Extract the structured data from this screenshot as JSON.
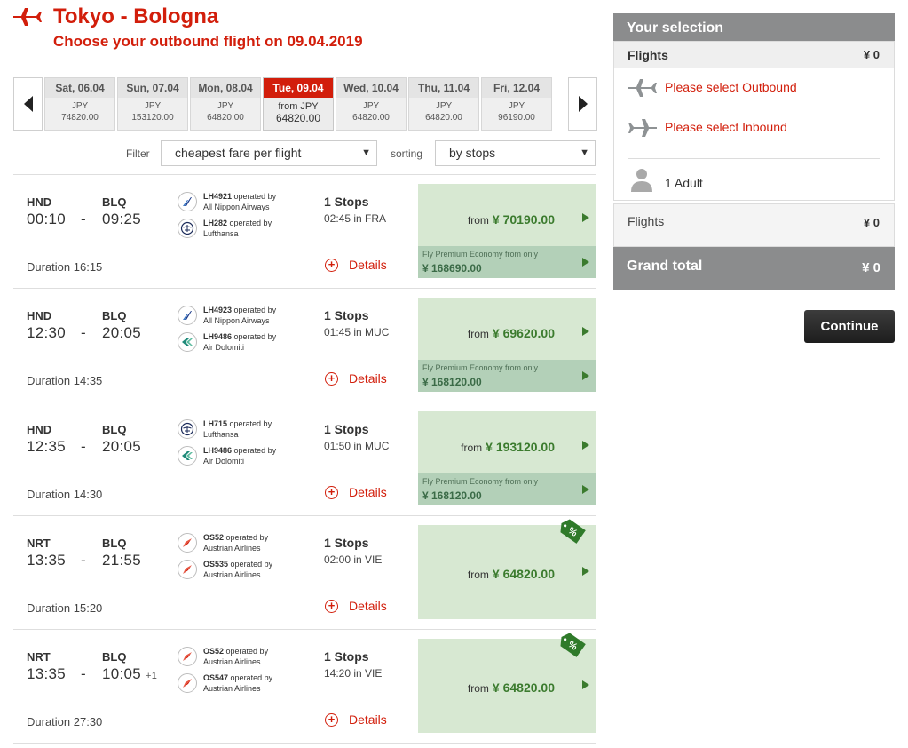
{
  "header": {
    "title": "Tokyo - Bologna",
    "subtitle": "Choose your outbound flight on 09.04.2019"
  },
  "date_carousel": {
    "prev_icon": "chevron-left-icon",
    "next_icon": "chevron-right-icon",
    "dates": [
      {
        "day": "Sat, 06.04",
        "currency": "JPY",
        "price": "74820.00",
        "active": false
      },
      {
        "day": "Sun, 07.04",
        "currency": "JPY",
        "price": "153120.00",
        "active": false
      },
      {
        "day": "Mon, 08.04",
        "currency": "JPY",
        "price": "64820.00",
        "active": false
      },
      {
        "day": "Tue, 09.04",
        "currency": "from JPY",
        "price": "64820.00",
        "active": true
      },
      {
        "day": "Wed, 10.04",
        "currency": "JPY",
        "price": "64820.00",
        "active": false
      },
      {
        "day": "Thu, 11.04",
        "currency": "JPY",
        "price": "64820.00",
        "active": false
      },
      {
        "day": "Fri, 12.04",
        "currency": "JPY",
        "price": "96190.00",
        "active": false
      }
    ]
  },
  "filters": {
    "filter_label": "Filter",
    "filter_value": "cheapest fare per flight",
    "sort_label": "sorting",
    "sort_value": "by stops"
  },
  "flights": [
    {
      "from": "HND",
      "to": "BLQ",
      "dep": "00:10",
      "dash": "-",
      "arr": "09:25",
      "plus_day": "",
      "duration": "Duration 16:15",
      "segments": [
        {
          "flight": "LH4921",
          "op": "operated by",
          "carrier": "All Nippon Airways",
          "logo": "ana"
        },
        {
          "flight": "LH282",
          "op": "operated by",
          "carrier": "Lufthansa",
          "logo": "lufthansa"
        }
      ],
      "stops": "1 Stops",
      "stop_info": "02:45 in FRA",
      "details": "Details",
      "fare_from": "from",
      "fare": "¥ 70190.00",
      "premium_label": "Fly Premium Economy from only",
      "premium_fare": "¥ 168690.00",
      "deal": false
    },
    {
      "from": "HND",
      "to": "BLQ",
      "dep": "12:30",
      "dash": "-",
      "arr": "20:05",
      "plus_day": "",
      "duration": "Duration 14:35",
      "segments": [
        {
          "flight": "LH4923",
          "op": "operated by",
          "carrier": "All Nippon Airways",
          "logo": "ana"
        },
        {
          "flight": "LH9486",
          "op": "operated by",
          "carrier": "Air Dolomiti",
          "logo": "dolomiti"
        }
      ],
      "stops": "1 Stops",
      "stop_info": "01:45 in MUC",
      "details": "Details",
      "fare_from": "from",
      "fare": "¥ 69620.00",
      "premium_label": "Fly Premium Economy from only",
      "premium_fare": "¥ 168120.00",
      "deal": false
    },
    {
      "from": "HND",
      "to": "BLQ",
      "dep": "12:35",
      "dash": "-",
      "arr": "20:05",
      "plus_day": "",
      "duration": "Duration 14:30",
      "segments": [
        {
          "flight": "LH715",
          "op": "operated by",
          "carrier": "Lufthansa",
          "logo": "lufthansa"
        },
        {
          "flight": "LH9486",
          "op": "operated by",
          "carrier": "Air Dolomiti",
          "logo": "dolomiti"
        }
      ],
      "stops": "1 Stops",
      "stop_info": "01:50 in MUC",
      "details": "Details",
      "fare_from": "from",
      "fare": "¥ 193120.00",
      "premium_label": "Fly Premium Economy from only",
      "premium_fare": "¥ 168120.00",
      "deal": false
    },
    {
      "from": "NRT",
      "to": "BLQ",
      "dep": "13:35",
      "dash": "-",
      "arr": "21:55",
      "plus_day": "",
      "duration": "Duration 15:20",
      "segments": [
        {
          "flight": "OS52",
          "op": "operated by",
          "carrier": "Austrian Airlines",
          "logo": "austrian"
        },
        {
          "flight": "OS535",
          "op": "operated by",
          "carrier": "Austrian Airlines",
          "logo": "austrian"
        }
      ],
      "stops": "1 Stops",
      "stop_info": "02:00 in VIE",
      "details": "Details",
      "fare_from": "from",
      "fare": "¥ 64820.00",
      "premium_label": "",
      "premium_fare": "",
      "deal": true
    },
    {
      "from": "NRT",
      "to": "BLQ",
      "dep": "13:35",
      "dash": "-",
      "arr": "10:05",
      "plus_day": "+1",
      "duration": "Duration 27:30",
      "segments": [
        {
          "flight": "OS52",
          "op": "operated by",
          "carrier": "Austrian Airlines",
          "logo": "austrian"
        },
        {
          "flight": "OS547",
          "op": "operated by",
          "carrier": "Austrian Airlines",
          "logo": "austrian"
        }
      ],
      "stops": "1 Stops",
      "stop_info": "14:20 in VIE",
      "details": "Details",
      "fare_from": "from",
      "fare": "¥ 64820.00",
      "premium_label": "",
      "premium_fare": "",
      "deal": true
    }
  ],
  "sidebar": {
    "title": "Your selection",
    "flights_label": "Flights",
    "flights_value": "¥ 0",
    "outbound_text": "Please select Outbound",
    "inbound_text": "Please select Inbound",
    "passengers": "1 Adult",
    "flights_row_label": "Flights",
    "flights_row_value": "¥ 0",
    "grand_total_label": "Grand total",
    "grand_total_value": "¥ 0",
    "continue_label": "Continue"
  },
  "colors": {
    "brand_red": "#d21e0b",
    "fare_green_bg": "#d7e8d2",
    "premium_green_bg": "#b3d0b8",
    "price_green": "#3b7b2e",
    "sidebar_grey": "#8b8c8d"
  }
}
